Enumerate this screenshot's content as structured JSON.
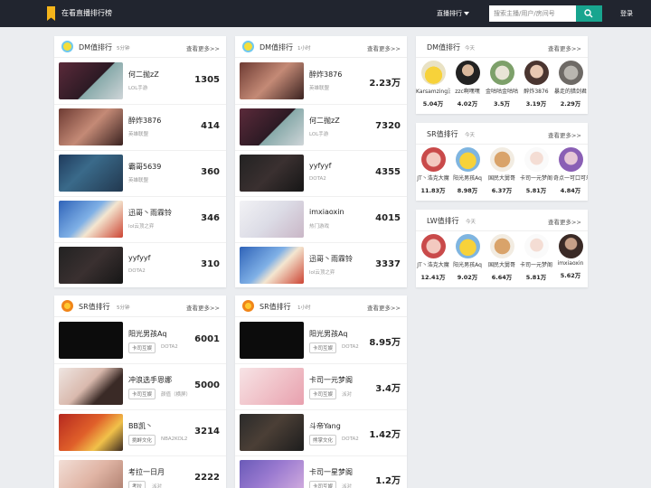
{
  "header": {
    "site_title": "在看直播排行榜",
    "nav_rank": "直播排行",
    "search_placeholder": "搜索主播/用户/房间号",
    "login": "登录"
  },
  "more_label": "查看更多>>",
  "dm_5min": {
    "title": "DM值排行",
    "period": "5分钟",
    "rows": [
      {
        "name": "何二抛zZ",
        "category": "LOL手游",
        "value": "1305"
      },
      {
        "name": "醉炸3876",
        "category": "英雄联盟",
        "value": "414"
      },
      {
        "name": "霸哥5639",
        "category": "英雄联盟",
        "value": "360"
      },
      {
        "name": "迅哥丶雨霖铃",
        "category": "lol云顶之弈",
        "value": "346"
      },
      {
        "name": "yyfyyf",
        "category": "DOTA2",
        "value": "310"
      }
    ]
  },
  "dm_1hour": {
    "title": "DM值排行",
    "period": "1小时",
    "rows": [
      {
        "name": "醉炸3876",
        "category": "英雄联盟",
        "value": "2.23万"
      },
      {
        "name": "何二抛zZ",
        "category": "LOL手游",
        "value": "7320"
      },
      {
        "name": "yyfyyf",
        "category": "DOTA2",
        "value": "4355"
      },
      {
        "name": "imxiaoxin",
        "category": "热门游戏",
        "value": "4015"
      },
      {
        "name": "迅哥丶雨霖铃",
        "category": "lol云顶之弈",
        "value": "3337"
      }
    ]
  },
  "sr_5min": {
    "title": "SR值排行",
    "period": "5分钟",
    "rows": [
      {
        "name": "阳光男孩Aq",
        "tag": "卡司互娱",
        "category": "DOTA2",
        "value": "6001"
      },
      {
        "name": "冲浪选手恩娜",
        "tag": "卡司互娱",
        "category": "颜值（横屏）",
        "value": "5000"
      },
      {
        "name": "BB凯丶",
        "tag": "挑衅文化",
        "category": "NBA2KOL2",
        "value": "3214"
      },
      {
        "name": "考拉一日月",
        "tag": "考拉",
        "category": "派对",
        "value": "2222"
      }
    ]
  },
  "sr_1hour": {
    "title": "SR值排行",
    "period": "1小时",
    "rows": [
      {
        "name": "阳光男孩Aq",
        "tag": "卡司互娱",
        "category": "DOTA2",
        "value": "8.95万"
      },
      {
        "name": "卡司一元梦阁",
        "tag": "卡司互娱",
        "category": "派对",
        "value": "3.4万"
      },
      {
        "name": "斗帝Yang",
        "tag": "熊掌文化",
        "category": "DOTA2",
        "value": "1.42万"
      },
      {
        "name": "卡司一星梦阁",
        "tag": "卡司互娱",
        "category": "派对",
        "value": "1.2万"
      }
    ]
  },
  "dm_today": {
    "title": "DM值排行",
    "period": "今天",
    "users": [
      {
        "name": "Karsamzing沃",
        "value": "5.04万"
      },
      {
        "name": "zzc啊嘿嘿",
        "value": "4.02万"
      },
      {
        "name": "金咕咕金咕咕",
        "value": "3.5万"
      },
      {
        "name": "醉炸3876",
        "value": "3.19万"
      },
      {
        "name": "暴走的猎剑君",
        "value": "2.29万"
      }
    ]
  },
  "sr_today": {
    "title": "SR值排行",
    "period": "今天",
    "users": [
      {
        "name": "JT丶浩克大魔",
        "value": "11.83万"
      },
      {
        "name": "阳光男孩Aq",
        "value": "8.98万"
      },
      {
        "name": "国民大舅哥",
        "value": "6.37万"
      },
      {
        "name": "卡司一元梦阁",
        "value": "5.81万"
      },
      {
        "name": "奇点一可口可乐",
        "value": "4.84万"
      }
    ]
  },
  "lw_today": {
    "title": "LW值排行",
    "period": "今天",
    "users": [
      {
        "name": "JT丶浩克大魔",
        "value": "12.41万"
      },
      {
        "name": "阳光男孩Aq",
        "value": "9.02万"
      },
      {
        "name": "国民大舅哥",
        "value": "6.64万"
      },
      {
        "name": "卡司一元梦阁",
        "value": "5.81万"
      },
      {
        "name": "imxiaoxin",
        "value": "5.62万"
      }
    ]
  }
}
